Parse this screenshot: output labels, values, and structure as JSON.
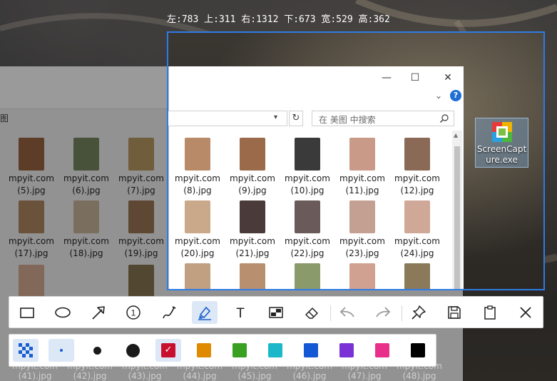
{
  "selection_info": "左:783  上:311  右:1312  下:673  宽:529  高:362",
  "back_explorer": {
    "breadcrumb": "图",
    "rows": [
      [
        "mpyit.com (5).jpg",
        "mpyit.com (6).jpg",
        "mpyit.com (7).jpg"
      ],
      [
        "mpyit.com (17).jpg",
        "mpyit.com (18).jpg",
        "mpyit.com (19).jpg"
      ]
    ],
    "bottom_labels": [
      "(41).jpg",
      "(42).jpg",
      "(43).jpg",
      "(44).jpg",
      "(45).jpg",
      "(46).jpg",
      "(47).jpg",
      "(48).jpg"
    ],
    "bottom_partial": [
      "mpyit.com",
      "mpyit.com",
      "mpyit.com",
      "mpyit.com",
      "mpyit.com",
      "mpyit.com",
      "mpyit.com",
      "mpyit.com"
    ]
  },
  "explorer": {
    "controls": {
      "minimize": "—",
      "maximize": "☐",
      "close": "✕"
    },
    "ribbon_chevron": "⌄",
    "help": "?",
    "search_placeholder": "在 美图 中搜索",
    "files": [
      [
        "mpyit.com",
        "(8).jpg"
      ],
      [
        "mpyit.com",
        "(9).jpg"
      ],
      [
        "mpyit.com",
        "(10).jpg"
      ],
      [
        "mpyit.com",
        "(11).jpg"
      ],
      [
        "mpyit.com",
        "(12).jpg"
      ],
      [
        "mpyit.com",
        "(20).jpg"
      ],
      [
        "mpyit.com",
        "(21).jpg"
      ],
      [
        "mpyit.com",
        "(22).jpg"
      ],
      [
        "mpyit.com",
        "(23).jpg"
      ],
      [
        "mpyit.com",
        "(24).jpg"
      ]
    ]
  },
  "desktop_icon": {
    "label_line1": "ScreenCapt",
    "label_line2": "ure.exe"
  },
  "toolbar": {
    "tools": [
      "rectangle-icon",
      "ellipse-icon",
      "arrow-icon",
      "number-icon",
      "pen-icon",
      "marker-icon",
      "text-icon",
      "mosaic-icon",
      "eraser-icon",
      "undo-icon",
      "redo-icon",
      "pin-icon",
      "save-icon",
      "copy-icon",
      "close-icon"
    ],
    "active_tool": "marker-icon",
    "number_glyph": "1",
    "text_glyph": "T"
  },
  "palette": {
    "colors": [
      "#c8102e",
      "#e08a00",
      "#3aa022",
      "#1ab8c8",
      "#1558d6",
      "#7a32d6",
      "#e8308a",
      "#000000"
    ],
    "selected_color": "#c8102e",
    "check": "✓"
  },
  "watermark": "mpyit.com"
}
